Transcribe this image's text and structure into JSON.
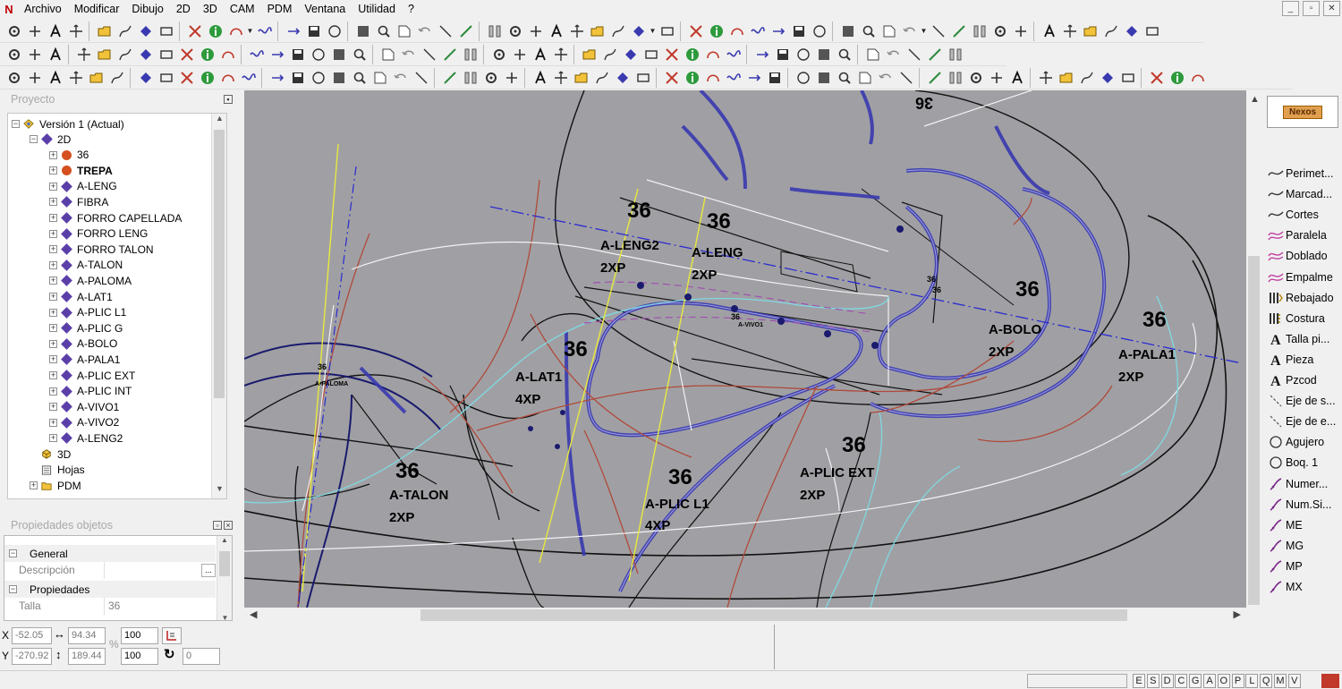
{
  "menu": [
    "Archivo",
    "Modificar",
    "Dibujo",
    "2D",
    "3D",
    "CAM",
    "PDM",
    "Ventana",
    "Utilidad",
    "?"
  ],
  "window_controls": [
    "_",
    "▫",
    "✕"
  ],
  "project": {
    "title": "Proyecto",
    "root": "Versión 1 (Actual)",
    "nodes": [
      {
        "label": "2D",
        "icon": "diamond-icon"
      },
      {
        "label": "36",
        "icon": "dot-icon"
      },
      {
        "label": "TREPA",
        "icon": "dot-icon",
        "bold": true
      },
      {
        "label": "A-LENG",
        "icon": "diamond-icon"
      },
      {
        "label": "FIBRA",
        "icon": "diamond-icon"
      },
      {
        "label": "FORRO CAPELLADA",
        "icon": "diamond-icon"
      },
      {
        "label": "FORRO LENG",
        "icon": "diamond-icon"
      },
      {
        "label": "FORRO TALON",
        "icon": "diamond-icon"
      },
      {
        "label": "A-TALON",
        "icon": "diamond-icon"
      },
      {
        "label": "A-PALOMA",
        "icon": "diamond-icon"
      },
      {
        "label": "A-LAT1",
        "icon": "diamond-icon"
      },
      {
        "label": "A-PLIC L1",
        "icon": "diamond-icon"
      },
      {
        "label": "A-PLIC G",
        "icon": "diamond-icon"
      },
      {
        "label": "A-BOLO",
        "icon": "diamond-icon"
      },
      {
        "label": "A-PALA1",
        "icon": "diamond-icon"
      },
      {
        "label": "A-PLIC EXT",
        "icon": "diamond-icon"
      },
      {
        "label": "A-PLIC INT",
        "icon": "diamond-icon"
      },
      {
        "label": "A-VIVO1",
        "icon": "diamond-icon"
      },
      {
        "label": "A-VIVO2",
        "icon": "diamond-icon"
      },
      {
        "label": "A-LENG2",
        "icon": "diamond-icon"
      },
      {
        "label": "3D",
        "icon": "cube-icon"
      },
      {
        "label": "Hojas",
        "icon": "sheet-icon"
      },
      {
        "label": "PDM",
        "icon": "folder-icon"
      }
    ]
  },
  "properties": {
    "title": "Propiedades objetos",
    "general": "General",
    "descripcion": "Descripción",
    "descripcion_btn": "...",
    "propiedades": "Propiedades",
    "talla_key": "Talla",
    "talla_val": "36"
  },
  "canvas": {
    "labels": {
      "size": "36",
      "a_leng2": "A-LENG2",
      "a_leng2_q": "2XP",
      "a_leng": "A-LENG",
      "a_leng_q": "2XP",
      "a_lat1": "A-LAT1",
      "a_lat1_q": "4XP",
      "a_bolo": "A-BOLO",
      "a_bolo_q": "2XP",
      "a_pala1": "A-PALA1",
      "a_pala1_q": "2XP",
      "a_talon": "A-TALON",
      "a_talon_q": "2XP",
      "a_plic_l1": "A-PLIC L1",
      "a_plic_l1_q": "4XP",
      "a_plic_ext": "A-PLIC EXT",
      "a_plic_ext_q": "2XP",
      "a_paloma": "A-PALOMA",
      "a_vivo1": "A-VIVO1"
    }
  },
  "right_panel": {
    "logo": "Nexos",
    "tools": [
      {
        "label": "Perimet...",
        "icon": "curve-icon"
      },
      {
        "label": "Marcad...",
        "icon": "curve-icon"
      },
      {
        "label": "Cortes",
        "icon": "curve-icon"
      },
      {
        "label": "Paralela",
        "icon": "parallel-icon"
      },
      {
        "label": "Doblado",
        "icon": "parallel-icon"
      },
      {
        "label": "Empalme",
        "icon": "parallel-icon"
      },
      {
        "label": "Rebajado",
        "icon": "rebajado-icon"
      },
      {
        "label": "Costura",
        "icon": "costura-icon"
      },
      {
        "label": "Talla pi...",
        "icon": "text-a-icon"
      },
      {
        "label": "Pieza",
        "icon": "text-a-icon"
      },
      {
        "label": "Pzcod",
        "icon": "text-a-icon"
      },
      {
        "label": "Eje de s...",
        "icon": "axis-icon"
      },
      {
        "label": "Eje de e...",
        "icon": "axis-icon"
      },
      {
        "label": "Agujero",
        "icon": "circle-icon"
      },
      {
        "label": "Boq. 1",
        "icon": "circle-icon"
      },
      {
        "label": "Numer...",
        "icon": "numbering-icon"
      },
      {
        "label": "Num.Si...",
        "icon": "numbering-icon"
      },
      {
        "label": "ME",
        "icon": "numbering-icon"
      },
      {
        "label": "MG",
        "icon": "numbering-icon"
      },
      {
        "label": "MP",
        "icon": "numbering-icon"
      },
      {
        "label": "MX",
        "icon": "numbering-icon"
      }
    ]
  },
  "coords": {
    "x_label": "X",
    "y_label": "Y",
    "x": "-52.05",
    "y": "-270.92",
    "dx": "94.34",
    "dy": "189.44",
    "percent": "%",
    "scale1": "100",
    "scale2": "100",
    "angle": "0"
  },
  "status_flags": [
    "E",
    "S",
    "D",
    "C",
    "G",
    "A",
    "O",
    "P",
    "L",
    "Q",
    "M",
    "V"
  ]
}
